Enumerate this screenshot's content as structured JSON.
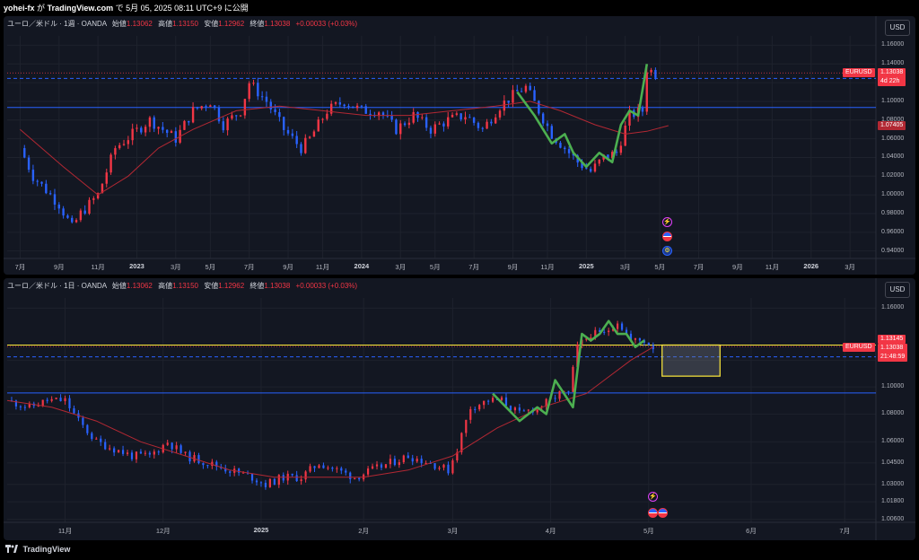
{
  "header": {
    "author": "yohei-fx",
    "connector": "が",
    "site": "TradingView.com",
    "rest": "で 5月 05, 2025 08:11 UTC+9 に公開"
  },
  "pane1": {
    "legend": {
      "symbol": "ユーロ／米ドル · 1週 · OANDA",
      "open_label": "始値",
      "open": "1.13062",
      "high_label": "高値",
      "high": "1.13150",
      "low_label": "安値",
      "low": "1.12962",
      "close_label": "終値",
      "close": "1.13038",
      "change": "+0.00033 (+0.03%)"
    },
    "currency_button": "USD",
    "yaxis": {
      "labels": [
        "1.16000",
        "1.14000",
        "1.12000",
        "1.10000",
        "1.08000",
        "1.06000",
        "1.04000",
        "1.02000",
        "1.00000",
        "0.98000",
        "0.96000",
        "0.94000"
      ],
      "values": [
        1.16,
        1.14,
        1.12,
        1.1,
        1.08,
        1.06,
        1.04,
        1.02,
        1.0,
        0.98,
        0.96,
        0.94
      ],
      "range": [
        0.932,
        1.17
      ]
    },
    "xaxis": [
      {
        "label": "7月",
        "x": 0
      },
      {
        "label": "9月",
        "x": 9
      },
      {
        "label": "11月",
        "x": 18
      },
      {
        "label": "2023",
        "x": 27,
        "bold": true
      },
      {
        "label": "3月",
        "x": 36
      },
      {
        "label": "5月",
        "x": 44
      },
      {
        "label": "7月",
        "x": 53
      },
      {
        "label": "9月",
        "x": 62
      },
      {
        "label": "11月",
        "x": 70
      },
      {
        "label": "2024",
        "x": 79,
        "bold": true
      },
      {
        "label": "3月",
        "x": 88
      },
      {
        "label": "5月",
        "x": 96
      },
      {
        "label": "7月",
        "x": 105
      },
      {
        "label": "9月",
        "x": 114
      },
      {
        "label": "11月",
        "x": 122
      },
      {
        "label": "2025",
        "x": 131,
        "bold": true
      },
      {
        "label": "3月",
        "x": 140
      },
      {
        "label": "5月",
        "x": 148
      },
      {
        "label": "7月",
        "x": 157
      },
      {
        "label": "9月",
        "x": 166
      },
      {
        "label": "11月",
        "x": 174
      },
      {
        "label": "2026",
        "x": 183,
        "bold": true
      },
      {
        "label": "3月",
        "x": 192
      }
    ],
    "price_tag": {
      "symbol": "EURUSD",
      "price": "1.13038",
      "countdown": "4d 22h",
      "value": 1.13038
    },
    "ma_tag": {
      "price": "1.07405",
      "value": 1.07405
    },
    "hlines": [
      {
        "value": 1.1245,
        "color": "#2962ff",
        "style": "dashed"
      },
      {
        "value": 1.0935,
        "color": "#2962ff",
        "style": "solid"
      }
    ],
    "chart_data": {
      "type": "candlestick",
      "x_unit": "weeks since Jul 2022",
      "x_range": [
        -3,
        198
      ],
      "keypoints": [
        [
          0,
          1.05
        ],
        [
          3,
          1.02
        ],
        [
          9,
          0.99
        ],
        [
          12,
          0.965
        ],
        [
          14,
          0.98
        ],
        [
          18,
          1.0
        ],
        [
          22,
          1.05
        ],
        [
          26,
          1.065
        ],
        [
          30,
          1.08
        ],
        [
          36,
          1.06
        ],
        [
          40,
          1.09
        ],
        [
          44,
          1.1
        ],
        [
          47,
          1.075
        ],
        [
          51,
          1.09
        ],
        [
          53,
          1.12
        ],
        [
          57,
          1.1
        ],
        [
          61,
          1.07
        ],
        [
          65,
          1.05
        ],
        [
          67,
          1.06
        ],
        [
          71,
          1.09
        ],
        [
          75,
          1.1
        ],
        [
          79,
          1.09
        ],
        [
          83,
          1.09
        ],
        [
          87,
          1.07
        ],
        [
          91,
          1.085
        ],
        [
          95,
          1.07
        ],
        [
          99,
          1.08
        ],
        [
          103,
          1.085
        ],
        [
          107,
          1.07
        ],
        [
          111,
          1.095
        ],
        [
          115,
          1.11
        ],
        [
          117,
          1.115
        ],
        [
          120,
          1.09
        ],
        [
          123,
          1.065
        ],
        [
          126,
          1.05
        ],
        [
          129,
          1.035
        ],
        [
          132,
          1.025
        ],
        [
          135,
          1.04
        ],
        [
          138,
          1.045
        ],
        [
          141,
          1.085
        ],
        [
          144,
          1.09
        ],
        [
          145,
          1.135
        ],
        [
          147,
          1.13
        ]
      ],
      "ma": [
        [
          0,
          1.07
        ],
        [
          10,
          1.03
        ],
        [
          18,
          1.0
        ],
        [
          25,
          1.02
        ],
        [
          32,
          1.05
        ],
        [
          40,
          1.07
        ],
        [
          50,
          1.09
        ],
        [
          60,
          1.095
        ],
        [
          70,
          1.09
        ],
        [
          80,
          1.085
        ],
        [
          90,
          1.085
        ],
        [
          100,
          1.09
        ],
        [
          110,
          1.095
        ],
        [
          118,
          1.1
        ],
        [
          125,
          1.09
        ],
        [
          133,
          1.075
        ],
        [
          140,
          1.065
        ],
        [
          145,
          1.068
        ],
        [
          150,
          1.074
        ]
      ],
      "green_curve": [
        [
          115,
          1.11
        ],
        [
          119,
          1.085
        ],
        [
          123,
          1.055
        ],
        [
          126,
          1.065
        ],
        [
          128,
          1.045
        ],
        [
          131,
          1.03
        ],
        [
          134,
          1.045
        ],
        [
          137,
          1.035
        ],
        [
          139,
          1.075
        ],
        [
          141,
          1.09
        ],
        [
          143,
          1.085
        ],
        [
          145,
          1.14
        ]
      ]
    }
  },
  "pane2": {
    "legend": {
      "symbol": "ユーロ／米ドル · 1日 · OANDA",
      "open_label": "始値",
      "open": "1.13062",
      "high_label": "高値",
      "high": "1.13150",
      "low_label": "安値",
      "low": "1.12962",
      "close_label": "終値",
      "close": "1.13038",
      "change": "+0.00033 (+0.03%)"
    },
    "currency_button": "USD",
    "yaxis": {
      "labels": [
        "1.16000",
        "1.12000",
        "1.10000",
        "1.08000",
        "1.06000",
        "1.04500",
        "1.03000",
        "1.01800",
        "1.00600"
      ],
      "values": [
        1.16,
        1.12,
        1.1,
        1.08,
        1.06,
        1.045,
        1.03,
        1.018,
        1.006
      ],
      "scale": "log",
      "range": [
        1.004,
        1.168
      ]
    },
    "xaxis": [
      {
        "label": "11月",
        "x": 13
      },
      {
        "label": "12月",
        "x": 35
      },
      {
        "label": "2025",
        "x": 57,
        "bold": true
      },
      {
        "label": "2月",
        "x": 80
      },
      {
        "label": "3月",
        "x": 100
      },
      {
        "label": "4月",
        "x": 122
      },
      {
        "label": "5月",
        "x": 144
      },
      {
        "label": "6月",
        "x": 167
      },
      {
        "label": "7月",
        "x": 188
      }
    ],
    "price_tag": {
      "symbol": "EURUSD",
      "price": "1.13038",
      "countdown": "21:48:59",
      "value": 1.13038
    },
    "yellow_tag": {
      "price": "1.13145",
      "value": 1.13145
    },
    "hlines": [
      {
        "value": 1.1315,
        "color": "#ffeb3b",
        "style": "solid"
      },
      {
        "value": 1.1225,
        "color": "#2962ff",
        "style": "dashed"
      },
      {
        "value": 1.0955,
        "color": "#2962ff",
        "style": "solid"
      }
    ],
    "zone": {
      "x1": 147,
      "x2": 160,
      "top": 1.1315,
      "bottom": 1.108
    },
    "chart_data": {
      "type": "candlestick",
      "x_unit": "days since mid-Oct 2024 (approx)",
      "x_range": [
        0,
        195
      ],
      "keypoints": [
        [
          0,
          1.09
        ],
        [
          5,
          1.085
        ],
        [
          9,
          1.09
        ],
        [
          13,
          1.09
        ],
        [
          16,
          1.075
        ],
        [
          20,
          1.06
        ],
        [
          24,
          1.055
        ],
        [
          28,
          1.05
        ],
        [
          32,
          1.05
        ],
        [
          36,
          1.06
        ],
        [
          40,
          1.05
        ],
        [
          45,
          1.045
        ],
        [
          50,
          1.04
        ],
        [
          55,
          1.035
        ],
        [
          58,
          1.03
        ],
        [
          62,
          1.035
        ],
        [
          66,
          1.035
        ],
        [
          70,
          1.045
        ],
        [
          74,
          1.04
        ],
        [
          78,
          1.035
        ],
        [
          82,
          1.04
        ],
        [
          86,
          1.045
        ],
        [
          90,
          1.05
        ],
        [
          95,
          1.045
        ],
        [
          99,
          1.04
        ],
        [
          101,
          1.055
        ],
        [
          104,
          1.085
        ],
        [
          108,
          1.09
        ],
        [
          111,
          1.09
        ],
        [
          115,
          1.08
        ],
        [
          119,
          1.085
        ],
        [
          122,
          1.09
        ],
        [
          124,
          1.095
        ],
        [
          126,
          1.095
        ],
        [
          128,
          1.13
        ],
        [
          131,
          1.14
        ],
        [
          134,
          1.14
        ],
        [
          137,
          1.15
        ],
        [
          140,
          1.135
        ],
        [
          143,
          1.135
        ],
        [
          145,
          1.13
        ]
      ],
      "ma": [
        [
          0,
          1.09
        ],
        [
          10,
          1.085
        ],
        [
          20,
          1.075
        ],
        [
          30,
          1.06
        ],
        [
          40,
          1.05
        ],
        [
          50,
          1.04
        ],
        [
          60,
          1.035
        ],
        [
          70,
          1.035
        ],
        [
          80,
          1.035
        ],
        [
          90,
          1.04
        ],
        [
          100,
          1.05
        ],
        [
          110,
          1.07
        ],
        [
          120,
          1.085
        ],
        [
          130,
          1.095
        ],
        [
          140,
          1.12
        ],
        [
          145,
          1.13
        ]
      ],
      "green_curve": [
        [
          109,
          1.095
        ],
        [
          112,
          1.085
        ],
        [
          115,
          1.075
        ],
        [
          117,
          1.08
        ],
        [
          119,
          1.085
        ],
        [
          121,
          1.08
        ],
        [
          123,
          1.105
        ],
        [
          125,
          1.095
        ],
        [
          127,
          1.085
        ],
        [
          129,
          1.14
        ],
        [
          131,
          1.135
        ],
        [
          133,
          1.14
        ],
        [
          135,
          1.15
        ],
        [
          137,
          1.14
        ],
        [
          139,
          1.14
        ],
        [
          141,
          1.13
        ],
        [
          143,
          1.135
        ]
      ]
    }
  },
  "footer": {
    "brand": "TradingView"
  },
  "colors": {
    "up": "#f23645",
    "down": "#2962ff",
    "ma": "#b22833",
    "green": "#4caf50",
    "bg": "#131722",
    "grid": "#1e222d",
    "yellow": "#ffeb3b",
    "blue": "#2962ff"
  },
  "icons": [
    "lightning-icon",
    "us-flag-icon",
    "eu-flag-icon",
    "tradingview-logo-icon"
  ]
}
